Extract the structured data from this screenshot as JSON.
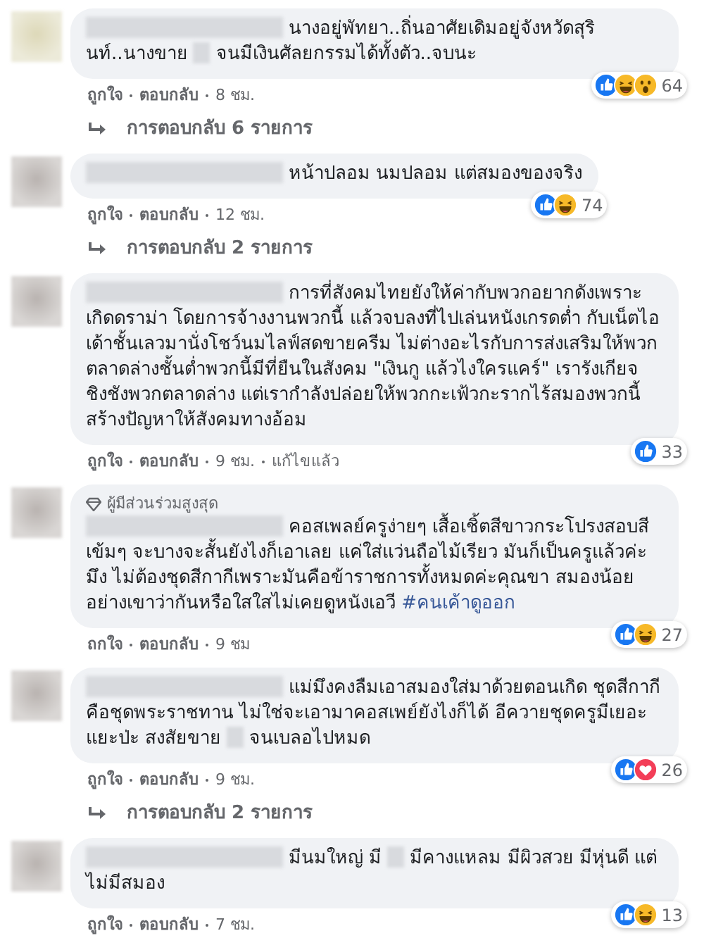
{
  "comments": [
    {
      "parts": [
        {
          "kind": "redacted"
        },
        {
          "kind": "text",
          "text": "นางอยู่พัทยา..ถิ่นอาศัยเดิมอยู่จังหวัดสุรินท์..นางขาย"
        },
        {
          "kind": "redacted_word"
        },
        {
          "kind": "text",
          "text": "จนมีเงินศัลยกรรมได้ทั้งตัว..จบนะ"
        }
      ],
      "reactions": [
        {
          "kind": "like"
        },
        {
          "kind": "haha"
        },
        {
          "kind": "wow"
        }
      ],
      "reaction_count": "64",
      "actions": [
        "ถูกใจ",
        "ตอบกลับ",
        "8 ชม."
      ],
      "replies": "การตอบกลับ 6 รายการ"
    },
    {
      "parts": [
        {
          "kind": "redacted"
        },
        {
          "kind": "text",
          "text": "หน้าปลอม นมปลอม แต่สมองของจริง"
        }
      ],
      "reactions": [
        {
          "kind": "like"
        },
        {
          "kind": "haha"
        }
      ],
      "reaction_count": "74",
      "actions": [
        "ถูกใจ",
        "ตอบกลับ",
        "12 ชม."
      ],
      "replies": "การตอบกลับ 2 รายการ"
    },
    {
      "parts": [
        {
          "kind": "redacted"
        },
        {
          "kind": "text",
          "text": "การที่สังคมไทยยังให้ค่ากับพวกอยากดังเพราะเกิดดราม่า โดยการจ้างงานพวกนี้ แล้วจบลงที่ไปเล่นหนังเกรดต่ำ กับเน็ตไอเด้าชั้นเลวมานั่งโชว์นมไลฟ์สดขายครีม ไม่ต่างอะไรกับการส่งเสริมให้พวกตลาดล่างชั้นต่ำพวกนี้มีที่ยืนในสังคม \"เงินกู แล้วไงใครแคร์\" เรารังเกียจชิงชังพวกตลาดล่าง แต่เรากำลังปล่อยให้พวกกะเฟ้วกะรากไร้สมองพวกนี้สร้างปัญหาให้สังคมทางอ้อม"
        }
      ],
      "reactions": [
        {
          "kind": "like"
        }
      ],
      "reaction_count": "33",
      "actions": [
        "ถูกใจ",
        "ตอบกลับ",
        "9 ชม.",
        "แก้ไขแล้ว"
      ]
    },
    {
      "top_fan_label": "ผู้มีส่วนร่วมสูงสุด",
      "parts": [
        {
          "kind": "redacted"
        },
        {
          "kind": "text",
          "text": "คอสเพลย์ครูง่ายๆ เสื้อเชิ้ตสีขาวกระโปรงสอบสีเข้มๆ จะบางจะสั้นยังไงก็เอาเลย แค่ใส่แว่นถือไม้เรียว มันก็เป็นครูแล้วค่ะมึง ไม่ต้องชุดสีกากีเพราะมันคือข้าราชการทั้งหมดค่ะคุณขา สมองน้อยอย่างเขาว่ากันหรือใสใสไม่เคยดูหนังเอวี "
        },
        {
          "kind": "hashtag",
          "text": "#คนเค้าดูออก"
        }
      ],
      "reactions": [
        {
          "kind": "like"
        },
        {
          "kind": "haha"
        }
      ],
      "reaction_count": "27",
      "actions": [
        "ถกใจ",
        "ตอบกลับ",
        "9 ชม"
      ]
    },
    {
      "parts": [
        {
          "kind": "redacted"
        },
        {
          "kind": "text",
          "text": "แม่มึงคงลืมเอาสมองใส่มาด้วยตอนเกิด ชุดสีกากีคือชุดพระราชทาน ไม่ใช่จะเอามาคอสเพย์ยังไงก็ได้ อีควายชุดครูมีเยอะแยะป่ะ สงสัยขาย"
        },
        {
          "kind": "redacted_word"
        },
        {
          "kind": "text",
          "text": "จนเบลอไปหมด"
        }
      ],
      "reactions": [
        {
          "kind": "like"
        },
        {
          "kind": "love"
        }
      ],
      "reaction_count": "26",
      "actions": [
        "ถูกใจ",
        "ตอบกลับ",
        "9 ชม."
      ],
      "replies": "การตอบกลับ 2 รายการ"
    },
    {
      "parts": [
        {
          "kind": "redacted"
        },
        {
          "kind": "text",
          "text": "มีนมใหญ่ มี"
        },
        {
          "kind": "redacted_word"
        },
        {
          "kind": "text",
          "text": "มีคางแหลม มีผิวสวย มีหุ่นดี แต่ไม่มีสมอง"
        }
      ],
      "reactions": [
        {
          "kind": "like"
        },
        {
          "kind": "haha"
        }
      ],
      "reaction_count": "13",
      "actions": [
        "ถูกใจ",
        "ตอบกลับ",
        "7 ชม."
      ]
    }
  ]
}
